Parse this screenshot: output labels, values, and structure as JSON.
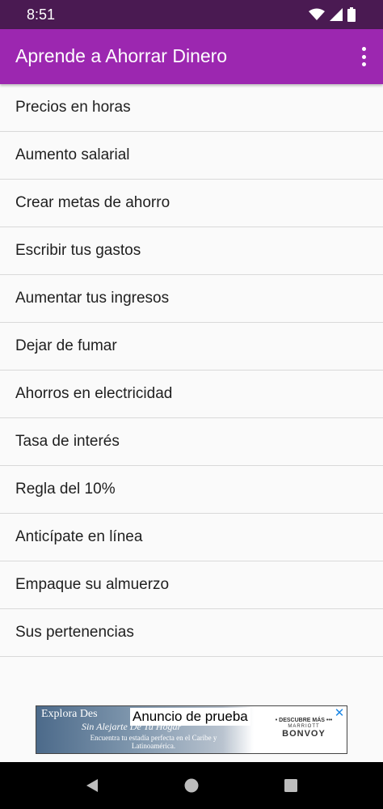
{
  "status_bar": {
    "time": "8:51",
    "icons": [
      "wifi-icon",
      "signal-icon",
      "battery-icon"
    ]
  },
  "app_bar": {
    "title": "Aprende a Ahorrar Dinero",
    "menu_icon": "more-vert-icon"
  },
  "list": {
    "items": [
      {
        "label": "Precios en horas"
      },
      {
        "label": "Aumento salarial"
      },
      {
        "label": "Crear metas de ahorro"
      },
      {
        "label": "Escribir tus gastos"
      },
      {
        "label": "Aumentar tus ingresos"
      },
      {
        "label": "Dejar de fumar"
      },
      {
        "label": "Ahorros en electricidad"
      },
      {
        "label": "Tasa de interés"
      },
      {
        "label": "Regla del 10%"
      },
      {
        "label": "Anticípate en línea"
      },
      {
        "label": "Empaque su almuerzo"
      },
      {
        "label": "Sus pertenencias"
      }
    ]
  },
  "ad": {
    "test_label": "Anuncio de prueba",
    "headline": "Explora Des",
    "subline": "Sin Alejarte De Tu Hogar",
    "body": "Encuentra tu estadía perfecta en el Caribe y Latinoamérica.",
    "right_line1": "• DESCUBRE MÁS •••",
    "right_line2": "MARRIOTT",
    "right_line3": "BONVOY",
    "close_icon": "close-icon"
  },
  "nav_bar": {
    "icons": [
      "back-icon",
      "home-icon",
      "recents-icon"
    ]
  },
  "colors": {
    "status_bar": "#4a1a52",
    "app_bar": "#9c27b0",
    "background": "#fafafa",
    "divider": "#d9d9d9",
    "text": "#1f1f1f"
  }
}
